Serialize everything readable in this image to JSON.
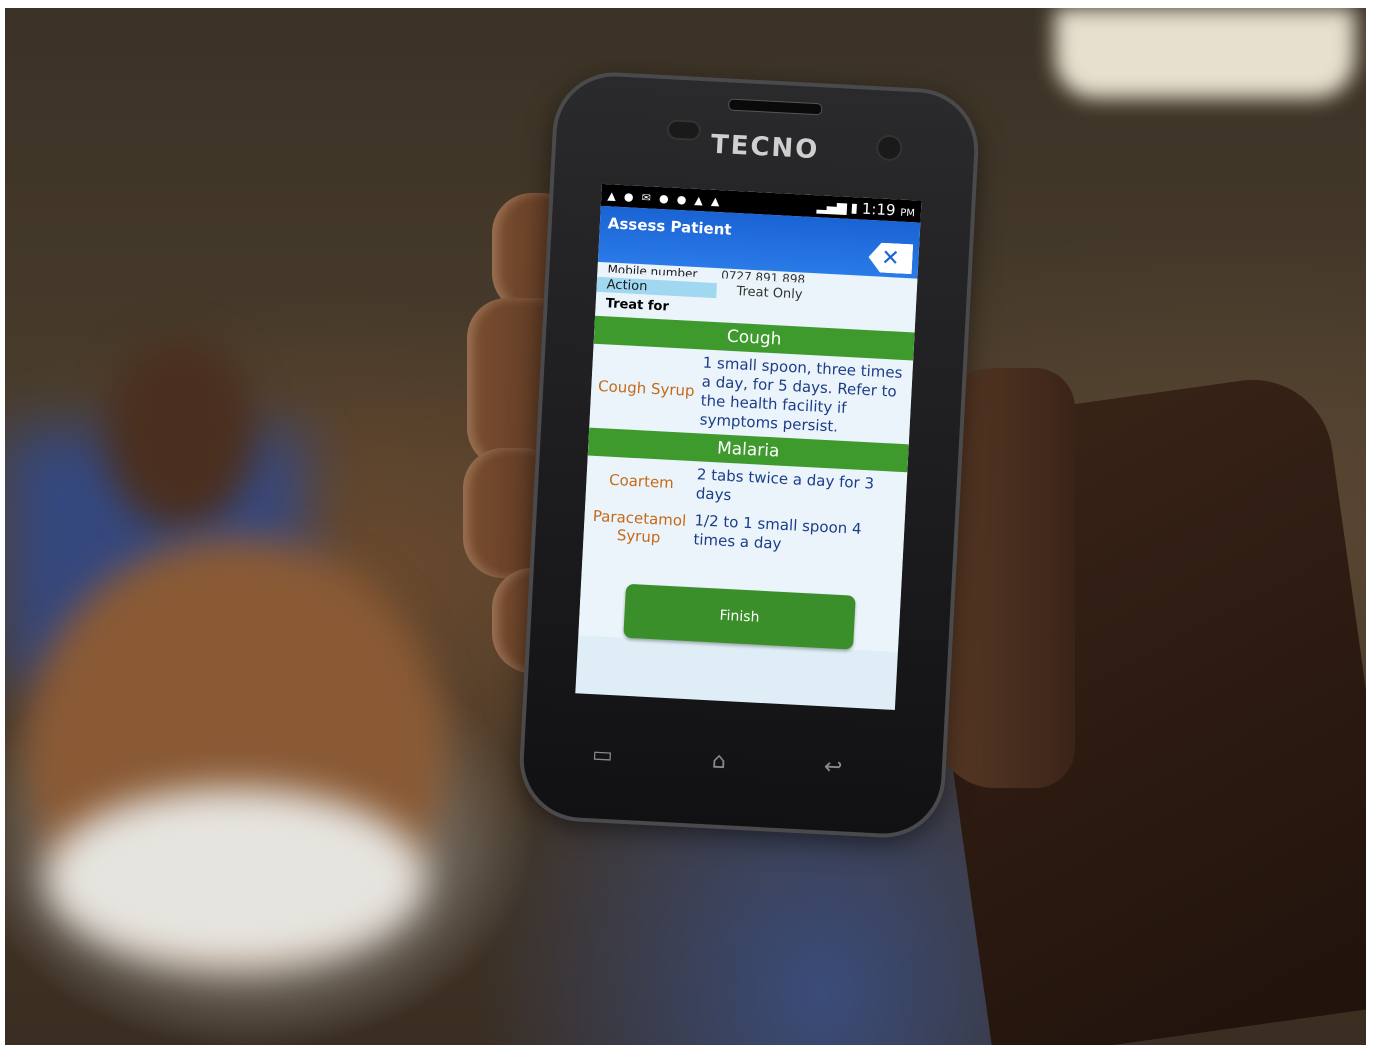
{
  "phone": {
    "brand": "TECNO"
  },
  "statusbar": {
    "time": "1:19",
    "ampm": "PM"
  },
  "appbar": {
    "title": "Assess Patient",
    "close_glyph": "✕"
  },
  "patient": {
    "mobile_label": "Mobile number",
    "mobile_value": "0727 891 898",
    "action_label": "Action",
    "action_value": "Treat Only",
    "treat_for_label": "Treat for"
  },
  "treatments": [
    {
      "condition": "Cough",
      "medications": [
        {
          "name": "Cough Syrup",
          "dose": "1 small spoon, three times a day, for 5 days. Refer to the health facility if symptoms persist."
        }
      ]
    },
    {
      "condition": "Malaria",
      "medications": [
        {
          "name": "Coartem",
          "dose": "2 tabs twice a day for 3 days"
        },
        {
          "name": "Paracetamol Syrup",
          "dose": "1/2 to 1 small spoon 4 times a day"
        }
      ]
    }
  ],
  "finish_label": "Finish",
  "icons": {
    "status": [
      "warning-icon",
      "runner-icon",
      "mail-icon",
      "runner-icon",
      "runner-icon",
      "warning-icon",
      "warning-icon"
    ],
    "nav": [
      "recent-apps-icon",
      "home-icon",
      "back-icon"
    ]
  },
  "colors": {
    "appbar": "#1a63d4",
    "section_header": "#3f9a2e",
    "medication_name": "#c56a17",
    "dose_text": "#1d3d8a",
    "finish_button": "#3a8f2a"
  }
}
